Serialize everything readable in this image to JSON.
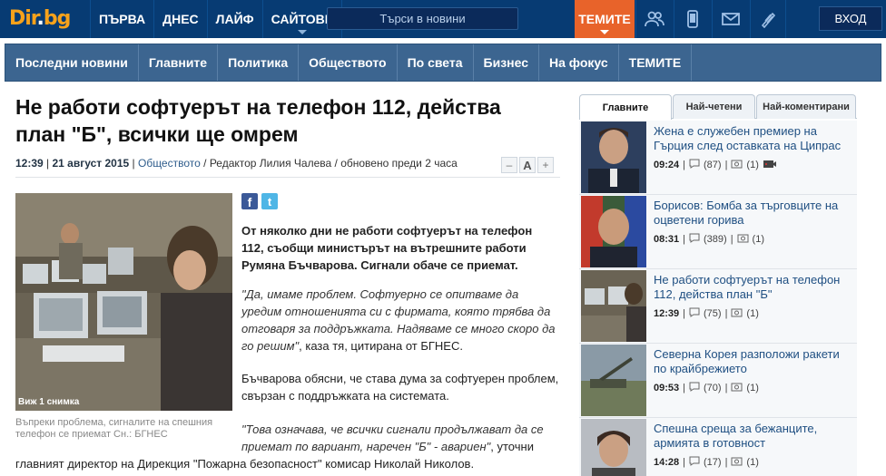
{
  "header": {
    "logo_main": "Dir",
    "logo_dot": ".",
    "logo_tld": "bg",
    "nav": [
      {
        "label": "ПЪРВА"
      },
      {
        "label": "ДНЕС"
      },
      {
        "label": "ЛАЙФ"
      },
      {
        "label": "САЙТОВЕ"
      }
    ],
    "search_placeholder": "Търси в новини",
    "topics_button": "ТЕМИТЕ",
    "login_button": "ВХОД",
    "icons": [
      "people-icon",
      "mobile-icon",
      "mail-icon",
      "rss-icon"
    ]
  },
  "secondary_nav": [
    {
      "label": "Последни новини"
    },
    {
      "label": "Главните"
    },
    {
      "label": "Политика"
    },
    {
      "label": "Обществото"
    },
    {
      "label": "По света"
    },
    {
      "label": "Бизнес"
    },
    {
      "label": "На фокус"
    },
    {
      "label": "ТЕМИТЕ"
    }
  ],
  "article": {
    "title": "Не работи софтуерът на телефон 112, действа план \"Б\", всички ще омрем",
    "time": "12:39",
    "date": "21 август 2015",
    "section": "Обществото",
    "editor": "Редактор Лилия Чалева",
    "updated": "обновено преди 2 часа",
    "font_minus": "–",
    "font_a": "A",
    "font_plus": "+",
    "photo_label": "Виж 1 снимка",
    "caption": "Въпреки проблема, сигналите на спешния телефон се приемат Сн.: БГНЕС",
    "lead": "От няколко дни не работи софтуерът на телефон 112, съобщи министърът на вътрешните работи Румяна Бъчварова. Сигнали обаче се приемат.",
    "p1_quote": "\"Да, имаме проблем. Софтуерно се опитваме да уредим отношенията си с фирмата, която трябва да отговаря за поддръжката. Надяваме се много скоро да го решим\"",
    "p1_tail": ", каза тя, цитирана от БГНЕС.",
    "p2": "Бъчварова обясни, че става дума за софтуерен проблем, свързан с поддръжката на системата.",
    "p3_quote": "\"Това означава, че всички сигнали продължават да се приемат по вариант, наречен \"Б\" - авариен\"",
    "p3_tail": ", уточни",
    "p3_cont": "главният директор на Дирекция \"Пожарна безопасност\" комисар Николай Николов."
  },
  "sidebar": {
    "tabs": [
      {
        "label": "Главните",
        "active": true
      },
      {
        "label": "Най-четени",
        "active": false
      },
      {
        "label": "Най-коментирани",
        "active": false
      }
    ],
    "items": [
      {
        "title": "Жена е служебен премиер на Гърция след оставката на Ципрас",
        "time": "09:24",
        "comments": "(87)",
        "photos": "(1)",
        "video": true
      },
      {
        "title": "Борисов: Бомба за търговците на оцветени горива",
        "time": "08:31",
        "comments": "(389)",
        "photos": "(1)",
        "video": false
      },
      {
        "title": "Не работи софтуерът на телефон 112, действа план \"Б\"",
        "time": "12:39",
        "comments": "(75)",
        "photos": "(1)",
        "video": false
      },
      {
        "title": "Северна Корея разположи ракети по крайбрежието",
        "time": "09:53",
        "comments": "(70)",
        "photos": "(1)",
        "video": false
      },
      {
        "title": "Спешна среща за бежанците, армията в готовност",
        "time": "14:28",
        "comments": "(17)",
        "photos": "(1)",
        "video": false
      }
    ]
  },
  "colors": {
    "topbar": "#073b73",
    "secnav": "#3c6590",
    "accent": "#e8632a",
    "link": "#1f4f82"
  }
}
